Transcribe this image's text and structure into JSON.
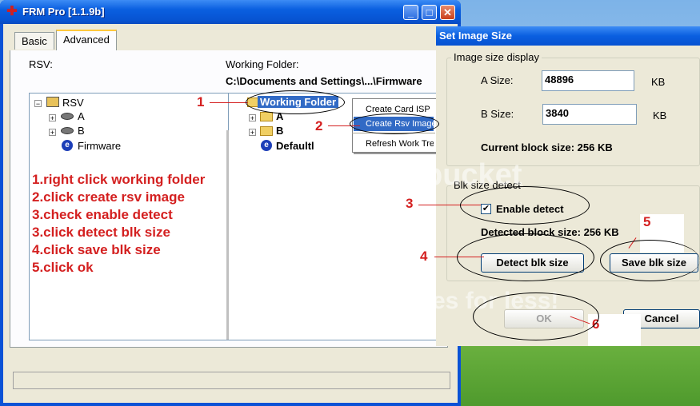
{
  "main_window": {
    "title": "FRM Pro [1.1.9b]",
    "title_icon": "✚",
    "tabs": [
      {
        "label": "Basic"
      },
      {
        "label": "Advanced"
      }
    ],
    "rsv_label": "RSV:",
    "working_folder_label": "Working Folder:",
    "working_folder_path": "C:\\Documents and Settings\\...\\Firmware",
    "left_tree": [
      {
        "label": "RSV",
        "expander": "−",
        "icon": "drive-icon"
      },
      {
        "label": "A",
        "expander": "+",
        "icon": "disk-icon"
      },
      {
        "label": "B",
        "expander": "+",
        "icon": "disk-icon"
      },
      {
        "label": "Firmware",
        "icon": "firmware-icon"
      }
    ],
    "right_tree": [
      {
        "label": "Working Folder",
        "icon": "folder-icon"
      },
      {
        "label": "A",
        "expander": "+",
        "icon": "folder-icon"
      },
      {
        "label": "B",
        "expander": "+",
        "icon": "folder-icon"
      },
      {
        "label": "Defaultl",
        "icon": "firmware-icon"
      }
    ]
  },
  "context_menu": {
    "items": [
      {
        "label": "Create Card ISP"
      },
      {
        "label": "Create Rsv Image"
      },
      {
        "label": "Refresh Work Tree"
      }
    ]
  },
  "instructions": [
    "1.right click working folder",
    "2.click create rsv image",
    "3.check enable detect",
    "3.click detect blk size",
    "4.click save blk size",
    "5.click ok"
  ],
  "dialog": {
    "title": "Set Image Size",
    "group_size_display": "Image size display",
    "a_size_label": "A Size:",
    "a_size_value": "48896",
    "a_unit": "KB",
    "b_size_label": "B Size:",
    "b_size_value": "3840",
    "b_unit": "KB",
    "current_block": "Current block size: 256 KB",
    "group_blk_detect": "Blk size detect",
    "enable_detect_label": "Enable detect",
    "enable_detect_checked": true,
    "detected_block": "Detected block size: 256 KB",
    "detect_button": "Detect blk size",
    "save_button": "Save blk size",
    "ok_button": "OK",
    "cancel_button": "Cancel"
  },
  "callouts": {
    "n1": "1",
    "n2": "2",
    "n3": "3",
    "n4": "4",
    "n5": "5",
    "n6": "6"
  },
  "watermark": {
    "line1": "bucket",
    "line2": "es for less!"
  },
  "colors": {
    "annotation_red": "#d42020",
    "selection_blue": "#316ac5",
    "title_blue": "#0a5fe0"
  }
}
